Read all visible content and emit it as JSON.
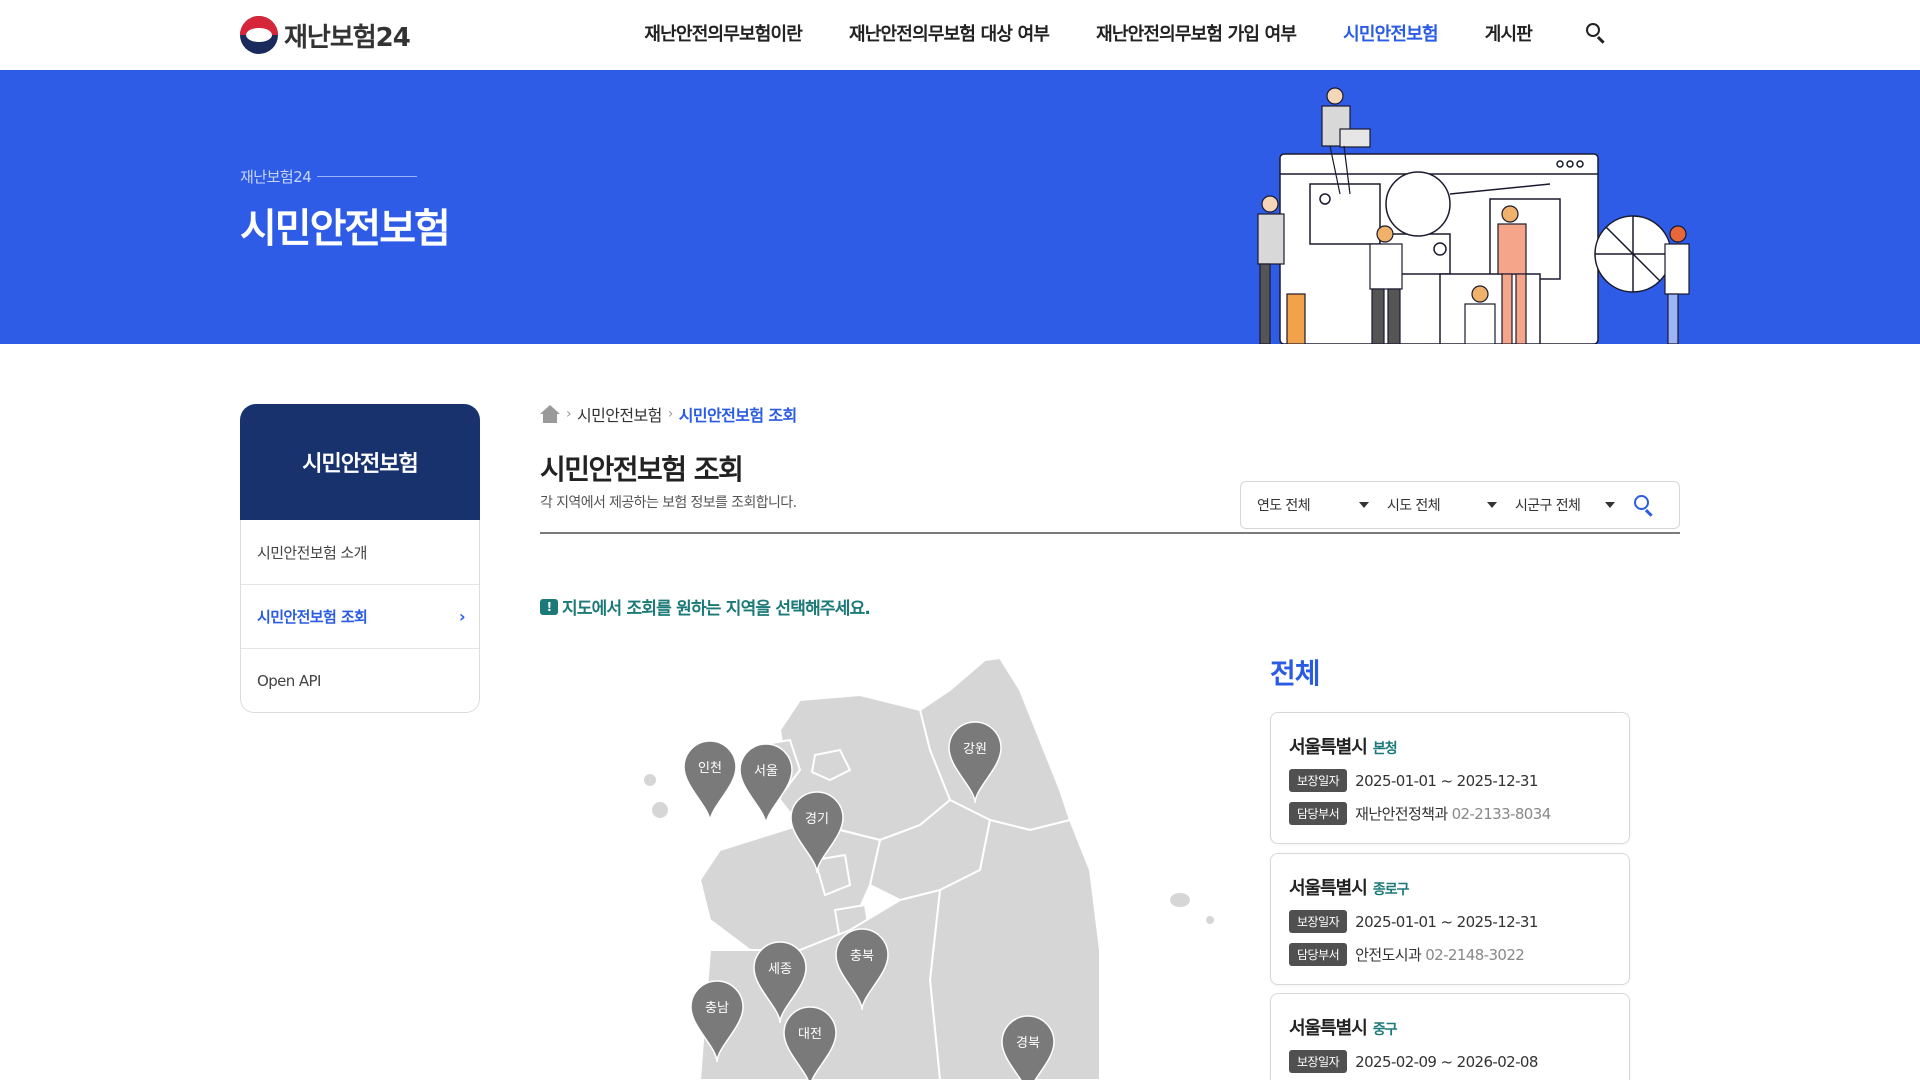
{
  "header": {
    "logo_text": "재난보험24",
    "nav": [
      {
        "label": "재난안전의무보험이란",
        "active": false
      },
      {
        "label": "재난안전의무보험 대상 여부",
        "active": false
      },
      {
        "label": "재난안전의무보험 가입 여부",
        "active": false
      },
      {
        "label": "시민안전보험",
        "active": true
      },
      {
        "label": "게시판",
        "active": false
      }
    ],
    "search_icon": "search-icon"
  },
  "hero": {
    "sub": "재난보험24",
    "title": "시민안전보험"
  },
  "sidebar": {
    "title": "시민안전보험",
    "items": [
      {
        "label": "시민안전보험 소개",
        "active": false
      },
      {
        "label": "시민안전보험 조회",
        "active": true
      },
      {
        "label": "Open API",
        "active": false
      }
    ]
  },
  "breadcrumb": {
    "items": [
      "시민안전보험",
      "시민안전보험 조회"
    ]
  },
  "page": {
    "title": "시민안전보험 조회",
    "desc": "각 지역에서 제공하는 보험 정보를 조회합니다."
  },
  "filters": {
    "year": "연도 전체",
    "sido": "시도 전체",
    "sigungu": "시군구 전체"
  },
  "notice": "지도에서 조회를 원하는 지역을 선택해주세요.",
  "map": {
    "markers": [
      "인천",
      "서울",
      "경기",
      "강원",
      "세종",
      "충북",
      "충남",
      "대전",
      "경북"
    ]
  },
  "results": {
    "title": "전체",
    "badge_period": "보장일자",
    "badge_dept": "담당부서",
    "cards": [
      {
        "city": "서울특별시",
        "district": "본청",
        "period": "2025-01-01 ~ 2025-12-31",
        "dept": "재난안전정책과",
        "phone": "02-2133-8034"
      },
      {
        "city": "서울특별시",
        "district": "종로구",
        "period": "2025-01-01 ~ 2025-12-31",
        "dept": "안전도시과",
        "phone": "02-2148-3022"
      },
      {
        "city": "서울특별시",
        "district": "중구",
        "period": "2025-02-09 ~ 2026-02-08",
        "dept": "",
        "phone": ""
      }
    ]
  },
  "colors": {
    "accent": "#2a5be3",
    "hero_bg": "#2e5ce6",
    "sidebar_head": "#18326e",
    "notice": "#1b7a78",
    "map_fill": "#d6d6d6",
    "marker": "#7a7a7a"
  }
}
